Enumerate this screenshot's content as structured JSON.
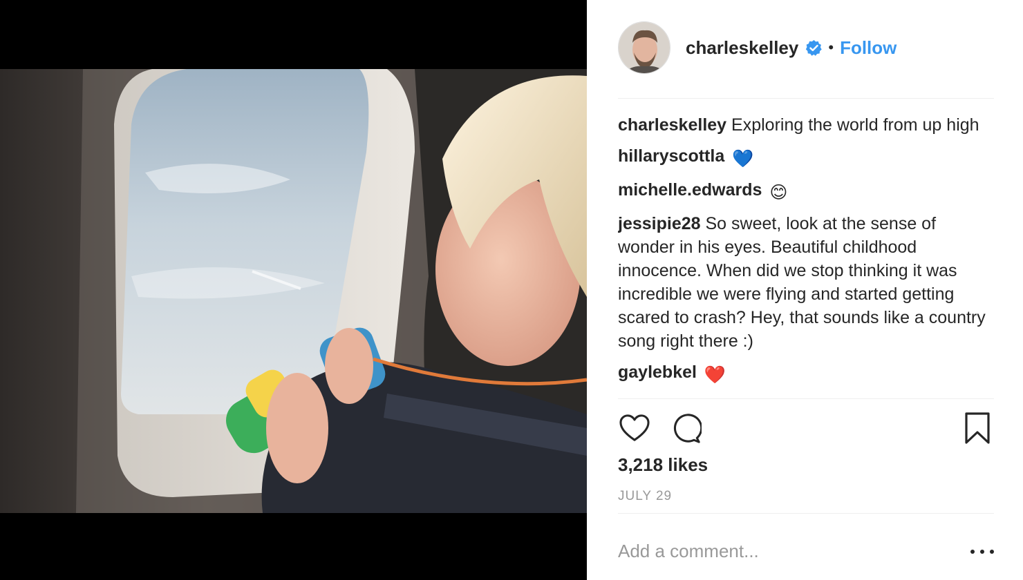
{
  "post": {
    "photo_alt": "Child looking out an airplane window holding toy binoculars"
  },
  "header": {
    "username": "charleskelley",
    "separator": "•",
    "follow_label": "Follow",
    "verified_icon": "verified-badge-icon"
  },
  "comments": [
    {
      "user": "charleskelley",
      "text": "Exploring the world from up high"
    },
    {
      "user": "hillaryscottla",
      "text": "💙"
    },
    {
      "user": "michelle.edwards",
      "text": "😊"
    },
    {
      "user": "jessipie28",
      "text": "So sweet, look at the sense of wonder in his eyes. Beautiful childhood innocence. When did we stop thinking it was incredible we were flying and started getting scared to crash? Hey, that sounds like a country song right there :)"
    },
    {
      "user": "gaylebkel",
      "text": "❤️"
    }
  ],
  "actions": {
    "like_icon": "heart-icon",
    "comment_icon": "comment-bubble-icon",
    "save_icon": "bookmark-icon"
  },
  "likes": "3,218 likes",
  "date": "JULY 29",
  "comment_input": {
    "placeholder": "Add a comment..."
  },
  "colors": {
    "link_blue": "#3897f0",
    "text": "#262626",
    "muted": "#999999",
    "divider": "#efefef"
  }
}
